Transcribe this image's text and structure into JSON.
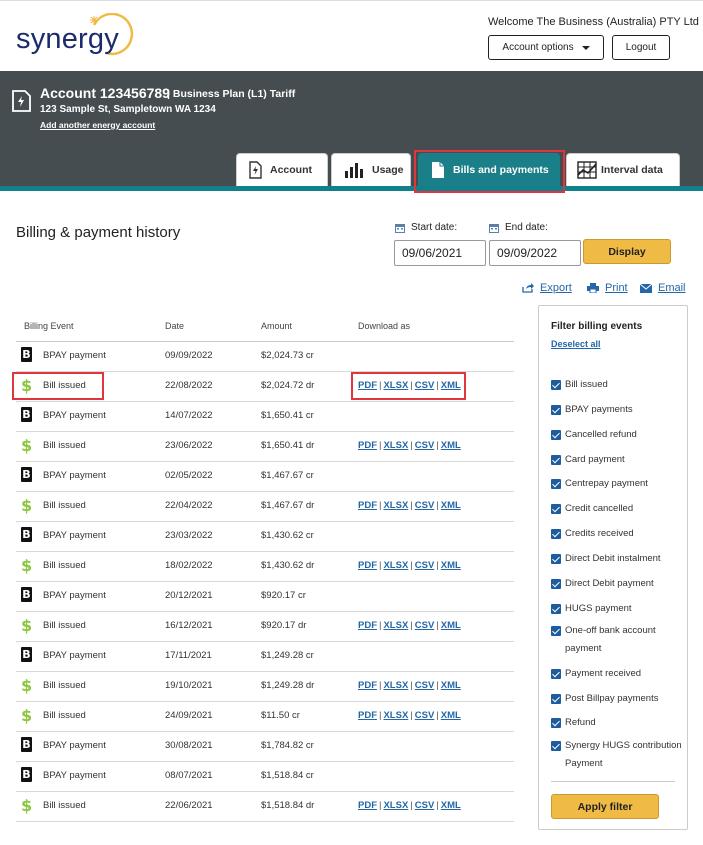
{
  "header": {
    "logo_text": "synergy",
    "welcome": "Welcome The Business (Australia) PTY Ltd",
    "account_options_label": "Account options",
    "logout_label": "Logout"
  },
  "account": {
    "number": "Account 123456789",
    "plan": "| Business Plan (L1) Tariff",
    "address": "123 Sample St, Sampletown WA 1234",
    "add_link": "Add another energy account"
  },
  "tabs": [
    {
      "label": "Account"
    },
    {
      "label": "Usage"
    },
    {
      "label": "Bills and payments",
      "active": true
    },
    {
      "label": "Interval data"
    }
  ],
  "page_title": "Billing & payment history",
  "date_filter": {
    "start_label": "Start date:",
    "end_label": "End date:",
    "start_value": "09/06/2021",
    "end_value": "09/09/2022",
    "display_label": "Display"
  },
  "tools": {
    "export": "Export",
    "print": "Print",
    "email": "Email"
  },
  "table": {
    "headers": [
      "Billing Event",
      "Date",
      "Amount",
      "Download as"
    ],
    "download_formats": [
      "PDF",
      "XLSX",
      "CSV",
      "XML"
    ],
    "rows": [
      {
        "type": "bpay",
        "event": "BPAY payment",
        "date": "09/09/2022",
        "amount": "$2,024.73 cr"
      },
      {
        "type": "bill",
        "event": "Bill issued",
        "date": "22/08/2022",
        "amount": "$2,024.72 dr"
      },
      {
        "type": "bpay",
        "event": "BPAY payment",
        "date": "14/07/2022",
        "amount": "$1,650.41 cr"
      },
      {
        "type": "bill",
        "event": "Bill issued",
        "date": "23/06/2022",
        "amount": "$1,650.41 dr"
      },
      {
        "type": "bpay",
        "event": "BPAY payment",
        "date": "02/05/2022",
        "amount": "$1,467.67 cr"
      },
      {
        "type": "bill",
        "event": "Bill issued",
        "date": "22/04/2022",
        "amount": "$1,467.67 dr"
      },
      {
        "type": "bpay",
        "event": "BPAY payment",
        "date": "23/03/2022",
        "amount": "$1,430.62 cr"
      },
      {
        "type": "bill",
        "event": "Bill issued",
        "date": "18/02/2022",
        "amount": "$1,430.62 dr"
      },
      {
        "type": "bpay",
        "event": "BPAY payment",
        "date": "20/12/2021",
        "amount": "$920.17 cr"
      },
      {
        "type": "bill",
        "event": "Bill issued",
        "date": "16/12/2021",
        "amount": "$920.17 dr"
      },
      {
        "type": "bpay",
        "event": "BPAY payment",
        "date": "17/11/2021",
        "amount": "$1,249.28 cr"
      },
      {
        "type": "bill",
        "event": "Bill issued",
        "date": "19/10/2021",
        "amount": "$1,249.28 dr"
      },
      {
        "type": "bill",
        "event": "Bill issued",
        "date": "24/09/2021",
        "amount": "$11.50 cr"
      },
      {
        "type": "bpay",
        "event": "BPAY payment",
        "date": "30/08/2021",
        "amount": "$1,784.82 cr"
      },
      {
        "type": "bpay",
        "event": "BPAY payment",
        "date": "08/07/2021",
        "amount": "$1,518.84 cr"
      },
      {
        "type": "bill",
        "event": "Bill issued",
        "date": "22/06/2021",
        "amount": "$1,518.84 dr"
      }
    ]
  },
  "filter": {
    "title": "Filter billing events",
    "deselect_label": "Deselect all",
    "items": [
      {
        "label": "Bill issued",
        "checked": true
      },
      {
        "label": "BPAY payments",
        "checked": true
      },
      {
        "label": "Cancelled refund",
        "checked": true
      },
      {
        "label": "Card payment",
        "checked": true
      },
      {
        "label": "Centrepay payment",
        "checked": true
      },
      {
        "label": "Credit cancelled",
        "checked": true
      },
      {
        "label": "Credits received",
        "checked": true
      },
      {
        "label": "Direct Debit instalment",
        "checked": true
      },
      {
        "label": "Direct Debit payment",
        "checked": true
      },
      {
        "label": "HUGS payment",
        "checked": true
      },
      {
        "label": "One-off bank account payment",
        "checked": true
      },
      {
        "label": "Payment received",
        "checked": true
      },
      {
        "label": "Post Billpay payments",
        "checked": true
      },
      {
        "label": "Refund",
        "checked": true
      },
      {
        "label": "Synergy HUGS contribution Payment",
        "checked": true
      }
    ],
    "apply_label": "Apply filter"
  },
  "colors": {
    "brand_dark": "#454d50",
    "teal": "#1a7f88",
    "accent_yellow": "#f0bb45",
    "link_blue": "#2467a8",
    "highlight_red": "#e0353c",
    "bill_green": "#8dc63f"
  }
}
